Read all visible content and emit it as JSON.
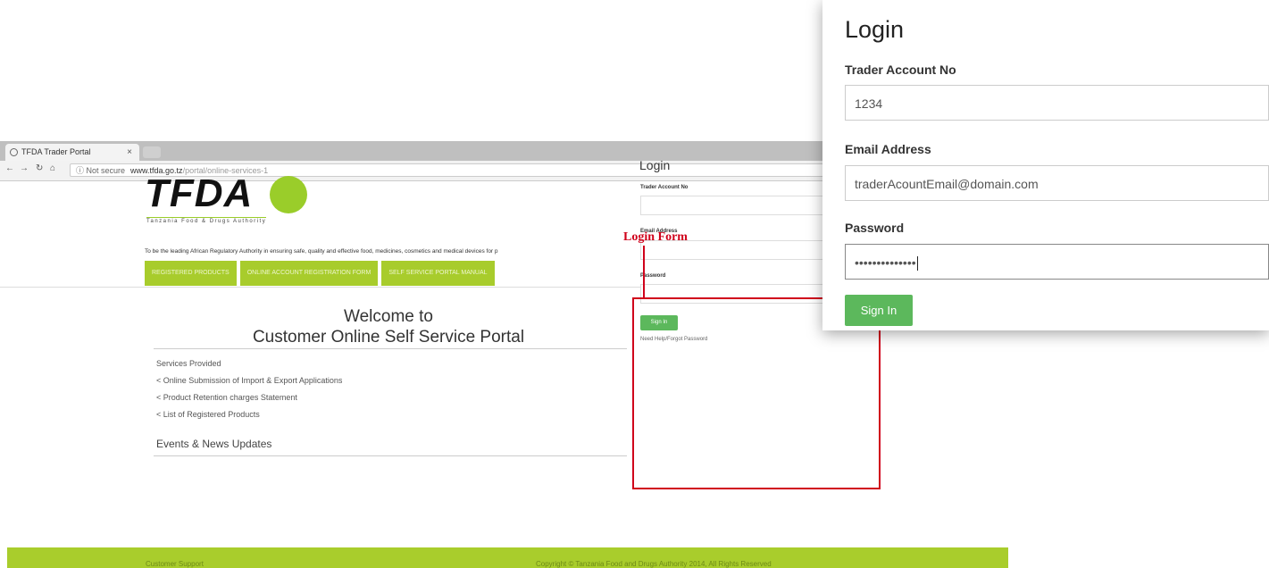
{
  "browser": {
    "tab_title": "TFDA Trader Portal",
    "tab_close": "×",
    "security": "ⓘ Not secure",
    "url_host": "www.tfda.go.tz",
    "url_path": "/portal/online-services-1"
  },
  "site": {
    "logo_text": "TFDA",
    "logo_sub": "Tanzania Food & Drugs Authority",
    "tagline": "To be the leading African Regulatory Authority in ensuring safe, quality and effective food, medicines, cosmetics and medical devices for p",
    "menu": [
      "REGISTERED PRODUCTS",
      "ONLINE ACCOUNT REGISTRATION FORM",
      "SELF SERVICE PORTAL MANUAL"
    ]
  },
  "welcome": {
    "line1": "Welcome to",
    "line2": "Customer Online Self Service Portal"
  },
  "services": {
    "heading": "Services Provided",
    "items": [
      "< Online Submission of Import & Export Applications",
      "< Product Retention charges Statement",
      "< List of Registered Products"
    ]
  },
  "events_title": "Events & News Updates",
  "small_login": {
    "title": "Login",
    "trader_label": "Trader Account No",
    "email_label": "Email Address",
    "password_label": "Password",
    "button": "Sign In",
    "help": "Need Help/Forgot Password"
  },
  "annotation": {
    "label": "Login Form",
    "color": "#d0021b"
  },
  "popup": {
    "title": "Login",
    "trader_label": "Trader Account No",
    "trader_value": "1234",
    "email_label": "Email Address",
    "email_value": "traderAcountEmail@domain.com",
    "password_label": "Password",
    "password_value": "••••••••••••••",
    "button": "Sign In"
  },
  "footer": {
    "left": "Customer Support",
    "right": "Copyright © Tanzania Food and Drugs Authority 2014, All Rights Reserved"
  },
  "colors": {
    "brand_green": "#a8cc2c",
    "button_green": "#5cb85c",
    "annotation_red": "#d0021b"
  }
}
